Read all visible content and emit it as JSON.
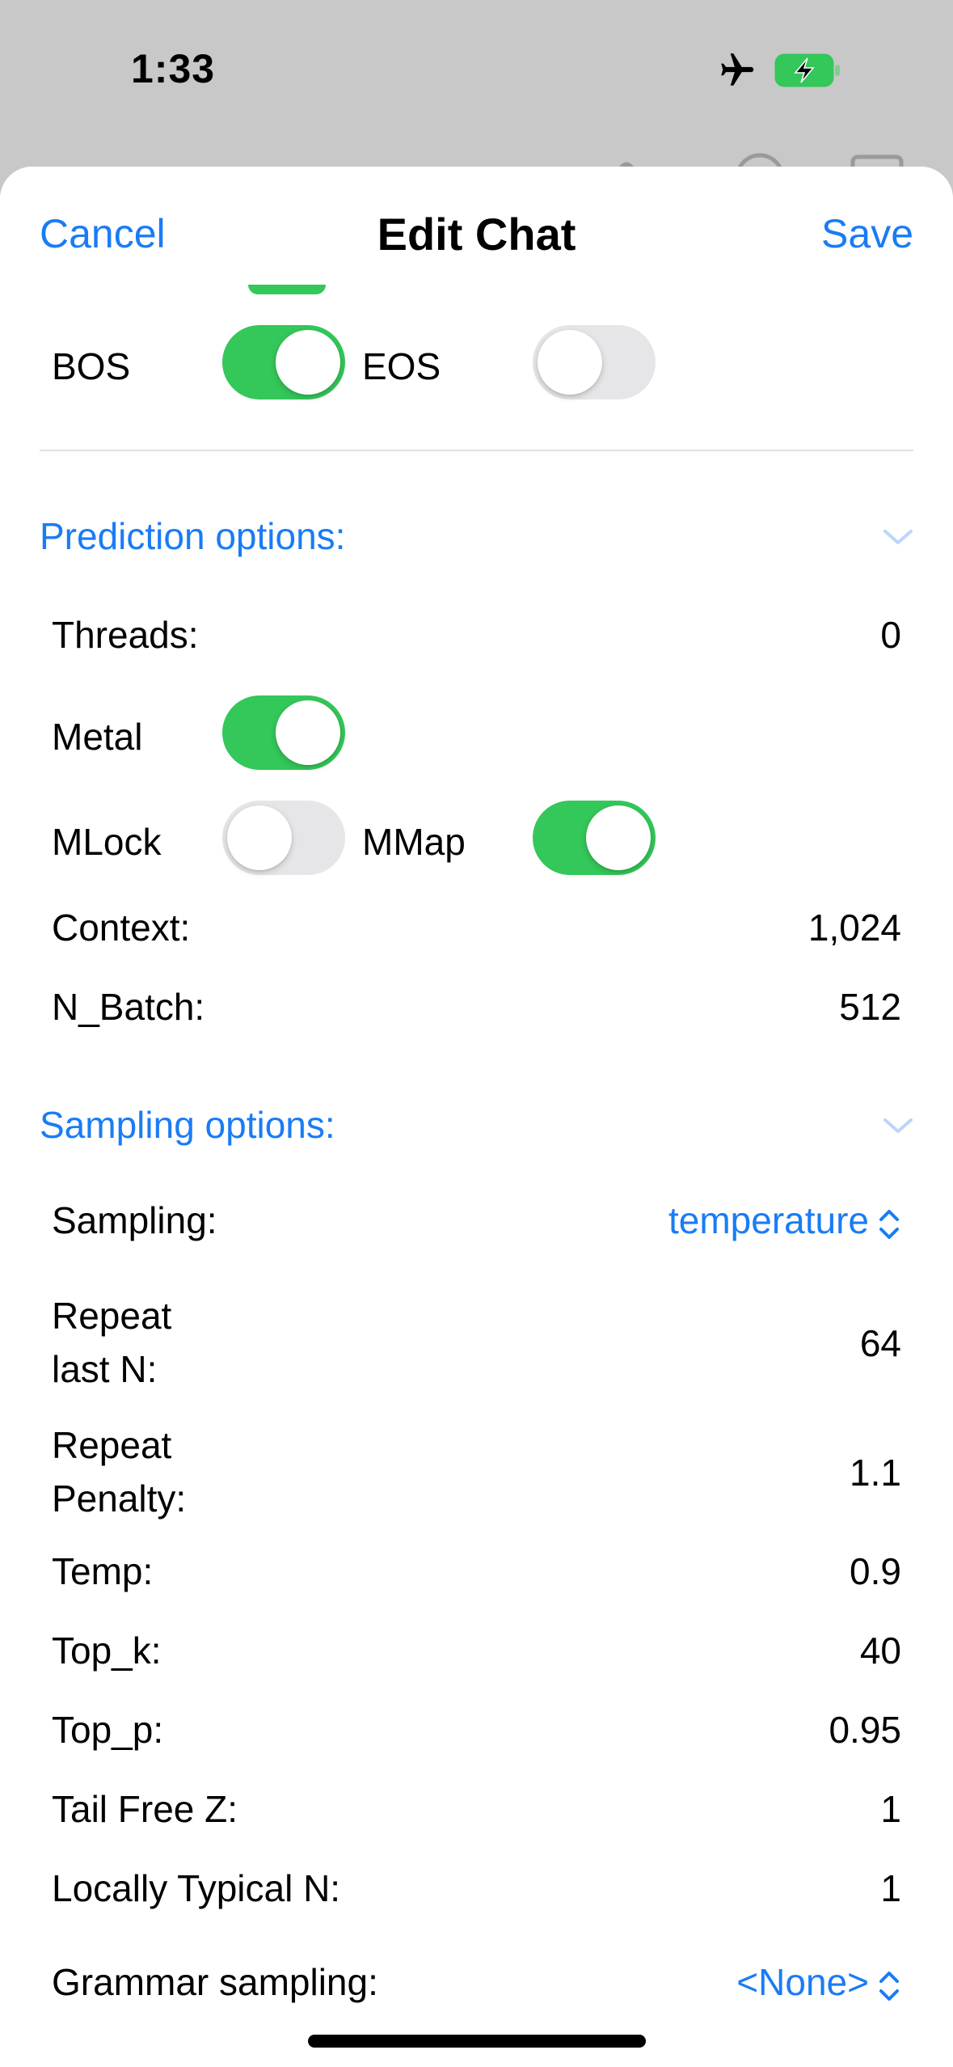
{
  "status_bar": {
    "time": "1:33",
    "icons": [
      "airplane-icon",
      "battery-charging-icon"
    ]
  },
  "nav": {
    "cancel_label": "Cancel",
    "title": "Edit Chat",
    "save_label": "Save"
  },
  "toggles_top": {
    "bos_label": "BOS",
    "bos_on": true,
    "eos_label": "EOS",
    "eos_on": false
  },
  "prediction": {
    "header": "Prediction options:",
    "threads_label": "Threads:",
    "threads_value": "0",
    "metal_label": "Metal",
    "metal_on": true,
    "mlock_label": "MLock",
    "mlock_on": false,
    "mmap_label": "MMap",
    "mmap_on": true,
    "context_label": "Context:",
    "context_value": "1,024",
    "nbatch_label": "N_Batch:",
    "nbatch_value": "512"
  },
  "sampling": {
    "header": "Sampling options:",
    "sampling_label": "Sampling:",
    "sampling_value": "temperature",
    "repeat_last_n_label_1": "Repeat",
    "repeat_last_n_label_2": "last N:",
    "repeat_last_n_value": "64",
    "repeat_penalty_label_1": "Repeat",
    "repeat_penalty_label_2": "Penalty:",
    "repeat_penalty_value": "1.1",
    "temp_label": "Temp:",
    "temp_value": "0.9",
    "top_k_label": "Top_k:",
    "top_k_value": "40",
    "top_p_label": "Top_p:",
    "top_p_value": "0.95",
    "tail_free_label": "Tail Free Z:",
    "tail_free_value": "1",
    "locally_typical_label": "Locally Typical N:",
    "locally_typical_value": "1",
    "grammar_label": "Grammar sampling:",
    "grammar_value": "<None>"
  },
  "colors": {
    "accent": "#1a7cf5",
    "toggle_on": "#34c759",
    "toggle_off": "#e6e6e8"
  }
}
